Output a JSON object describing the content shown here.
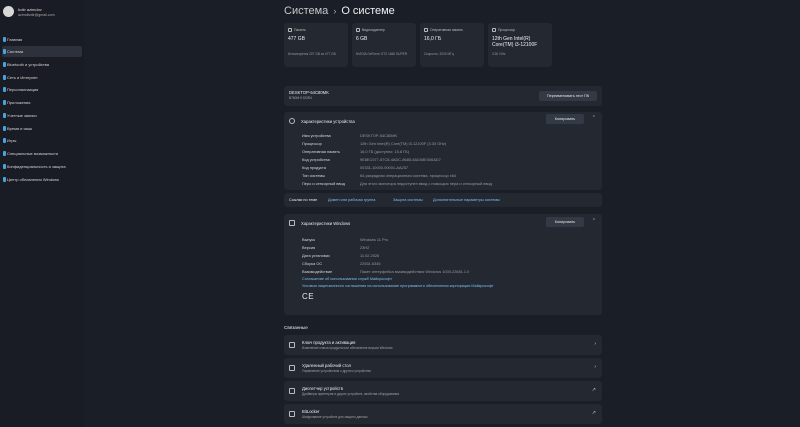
{
  "profile": {
    "name": "botir azimdov",
    "email": "azimdbotir@gmail.com"
  },
  "nav": [
    {
      "label": "Главная",
      "active": false
    },
    {
      "label": "Система",
      "active": true
    },
    {
      "label": "Bluetooth и устройства",
      "active": false
    },
    {
      "label": "Сеть и Интернет",
      "active": false
    },
    {
      "label": "Персонализация",
      "active": false
    },
    {
      "label": "Приложения",
      "active": false
    },
    {
      "label": "Учетные записи",
      "active": false
    },
    {
      "label": "Время и язык",
      "active": false
    },
    {
      "label": "Игры",
      "active": false
    },
    {
      "label": "Специальные возможности",
      "active": false
    },
    {
      "label": "Конфиденциальность и защита",
      "active": false
    },
    {
      "label": "Центр обновления Windows",
      "active": false
    }
  ],
  "breadcrumb": {
    "parent": "Система",
    "separator": "›",
    "current": "О системе"
  },
  "spec_cards": [
    {
      "title": "Память",
      "value": "477 GB",
      "sub": "Используется 207 GB из 477 GB"
    },
    {
      "title": "Видеоадаптер",
      "value": "6 GB",
      "sub": "NVIDIA GeForce GTX 1660 SUPER"
    },
    {
      "title": "Оперативная память",
      "value": "16,0 ГБ",
      "sub": "Скорость: 3200 МГц"
    },
    {
      "title": "Процессор",
      "value": "12th Gen Intel(R) Core(TM) i3-12100F",
      "sub": "3.30 GHz"
    }
  ],
  "device": {
    "name": "DESKTOP-54C80MK",
    "model": "B760M H DDR4",
    "rename_label": "Переименовать этот ПК"
  },
  "device_specs": {
    "title": "Характеристики устройства",
    "copy_label": "Копировать",
    "rows": [
      {
        "k": "Имя устройства",
        "v": "DESKTOP-54C80MK"
      },
      {
        "k": "Процессор",
        "v": "12th Gen Intel(R) Core(TM) i3-12100F (3.30 GHz)"
      },
      {
        "k": "Оперативная память",
        "v": "16,0 ГБ (доступно: 15,8 ГБ)"
      },
      {
        "k": "Код устройства",
        "v": "9E8EC577-87C8-4ADC-8685-8AD08E006AD7"
      },
      {
        "k": "Код продукта",
        "v": "00331-10000-00001-AA257"
      },
      {
        "k": "Тип системы",
        "v": "64-разрядная операционная система, процессор x64"
      },
      {
        "k": "Перо и сенсорный ввод",
        "v": "Для этого монитора недоступен ввод с помощью пера и сенсорный ввод"
      }
    ]
  },
  "links_bar": {
    "heading": "Ссылки по теме",
    "links": [
      "Домен или рабочая группа",
      "Защита системы",
      "Дополнительные параметры системы"
    ]
  },
  "windows_specs": {
    "title": "Характеристики Windows",
    "copy_label": "Копировать",
    "rows": [
      {
        "k": "Выпуск",
        "v": "Windows 11 Pro"
      },
      {
        "k": "Версия",
        "v": "23H2"
      },
      {
        "k": "Дата установки",
        "v": "11.02.2026"
      },
      {
        "k": "Сборка ОС",
        "v": "22631.6345"
      },
      {
        "k": "Взаимодействие",
        "v": "Пакет интерфейса взаимодействия Windows 1000.22681.1.0"
      }
    ],
    "links": [
      "Соглашение об использовании служб Майкрософт",
      "Условия лицензионного соглашения на использование программного обеспечения корпорации Майкрософт"
    ],
    "ce_mark": "CE"
  },
  "related": {
    "title": "Связанные",
    "items": [
      {
        "title": "Ключ продукта и активация",
        "sub": "Изменение ключа продукта или обновление версии Windows",
        "arrow": "›"
      },
      {
        "title": "Удаленный рабочий стол",
        "sub": "Управление устройством с другого устройства",
        "arrow": "›"
      },
      {
        "title": "Диспетчер устройств",
        "sub": "Драйверы принтеров и других устройств, свойства оборудования",
        "arrow": "↗"
      },
      {
        "title": "BitLocker",
        "sub": "Шифрование устройств для защиты данных",
        "arrow": "↗"
      }
    ]
  }
}
